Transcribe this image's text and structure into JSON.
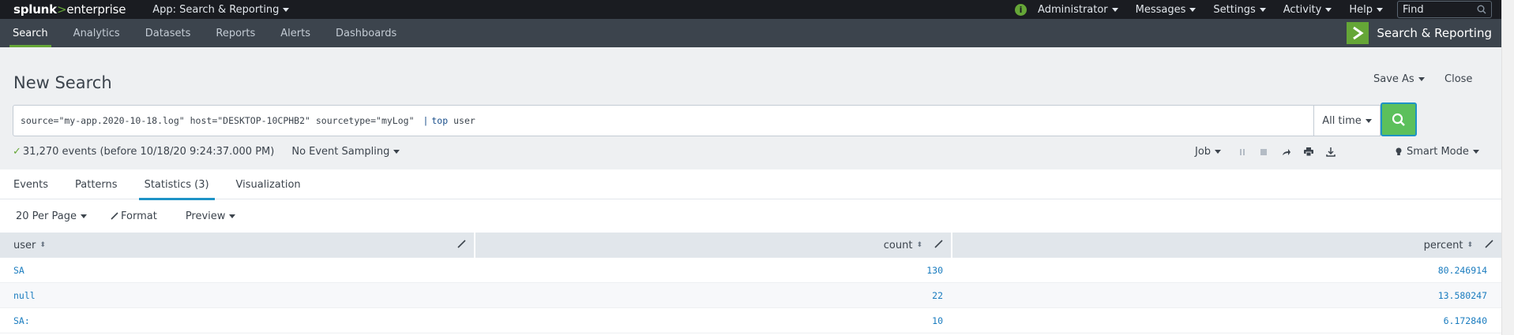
{
  "topbar": {
    "logo_main": "splunk",
    "logo_sep": ">",
    "logo_sub": "enterprise",
    "app_menu": "App: Search & Reporting",
    "menus": [
      "Administrator",
      "Messages",
      "Settings",
      "Activity",
      "Help"
    ],
    "find_placeholder": "Find"
  },
  "nav": {
    "items": [
      "Search",
      "Analytics",
      "Datasets",
      "Reports",
      "Alerts",
      "Dashboards"
    ],
    "active": "Search",
    "app_title": "Search & Reporting"
  },
  "page": {
    "title": "New Search",
    "save_as": "Save As",
    "close": "Close"
  },
  "search": {
    "query_part1": "source=\"my-app.2020-10-18.log\" host=\"DESKTOP-10CPHB2\" sourcetype=\"myLog\"",
    "pipe": "|",
    "command": "top",
    "args": "user",
    "time_range": "All time"
  },
  "status": {
    "events_text": "31,270 events (before 10/18/20 9:24:37.000 PM)",
    "sampling": "No Event Sampling",
    "job": "Job",
    "mode": "Smart Mode"
  },
  "tabs": {
    "items": [
      "Events",
      "Patterns",
      "Statistics (3)",
      "Visualization"
    ],
    "active": "Statistics (3)"
  },
  "toolbar": {
    "per_page": "20 Per Page",
    "format": "Format",
    "preview": "Preview"
  },
  "table": {
    "columns": [
      "user",
      "count",
      "percent"
    ],
    "rows": [
      {
        "user": "SA",
        "count": "130",
        "percent": "80.246914"
      },
      {
        "user": "null",
        "count": "22",
        "percent": "13.580247"
      },
      {
        "user": "SA:",
        "count": "10",
        "percent": "6.172840"
      }
    ]
  },
  "colors": {
    "accent_green": "#65a637",
    "accent_blue": "#1e93c6",
    "topbar_bg": "#1a1c21",
    "navbar_bg": "#3c444d"
  }
}
